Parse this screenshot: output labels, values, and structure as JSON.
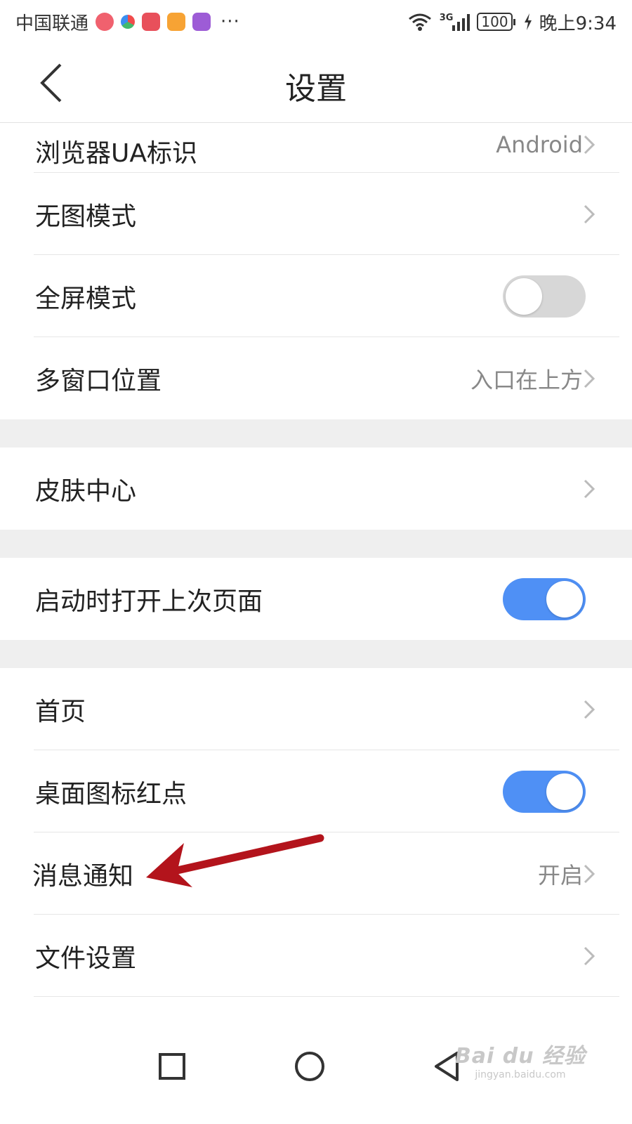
{
  "status_bar": {
    "carrier": "中国联通",
    "network": "3G",
    "battery": "100",
    "time": "晚上9:34",
    "more": "···"
  },
  "header": {
    "title": "设置"
  },
  "settings": {
    "ua": {
      "label": "浏览器UA标识",
      "value": "Android"
    },
    "no_image": {
      "label": "无图模式"
    },
    "fullscreen": {
      "label": "全屏模式",
      "enabled": false
    },
    "multi_window": {
      "label": "多窗口位置",
      "value": "入口在上方"
    },
    "skin": {
      "label": "皮肤中心"
    },
    "restore": {
      "label": "启动时打开上次页面",
      "enabled": true
    },
    "homepage": {
      "label": "首页"
    },
    "red_dot": {
      "label": "桌面图标红点",
      "enabled": true
    },
    "notification": {
      "label": "消息通知",
      "value": "开启"
    },
    "file": {
      "label": "文件设置"
    }
  },
  "watermark": {
    "main": "Bai du 经验",
    "sub": "jingyan.baidu.com"
  },
  "colors": {
    "toggle_on": "#4f90f5",
    "toggle_off": "#d7d7d7",
    "arrow": "#b3141c"
  }
}
